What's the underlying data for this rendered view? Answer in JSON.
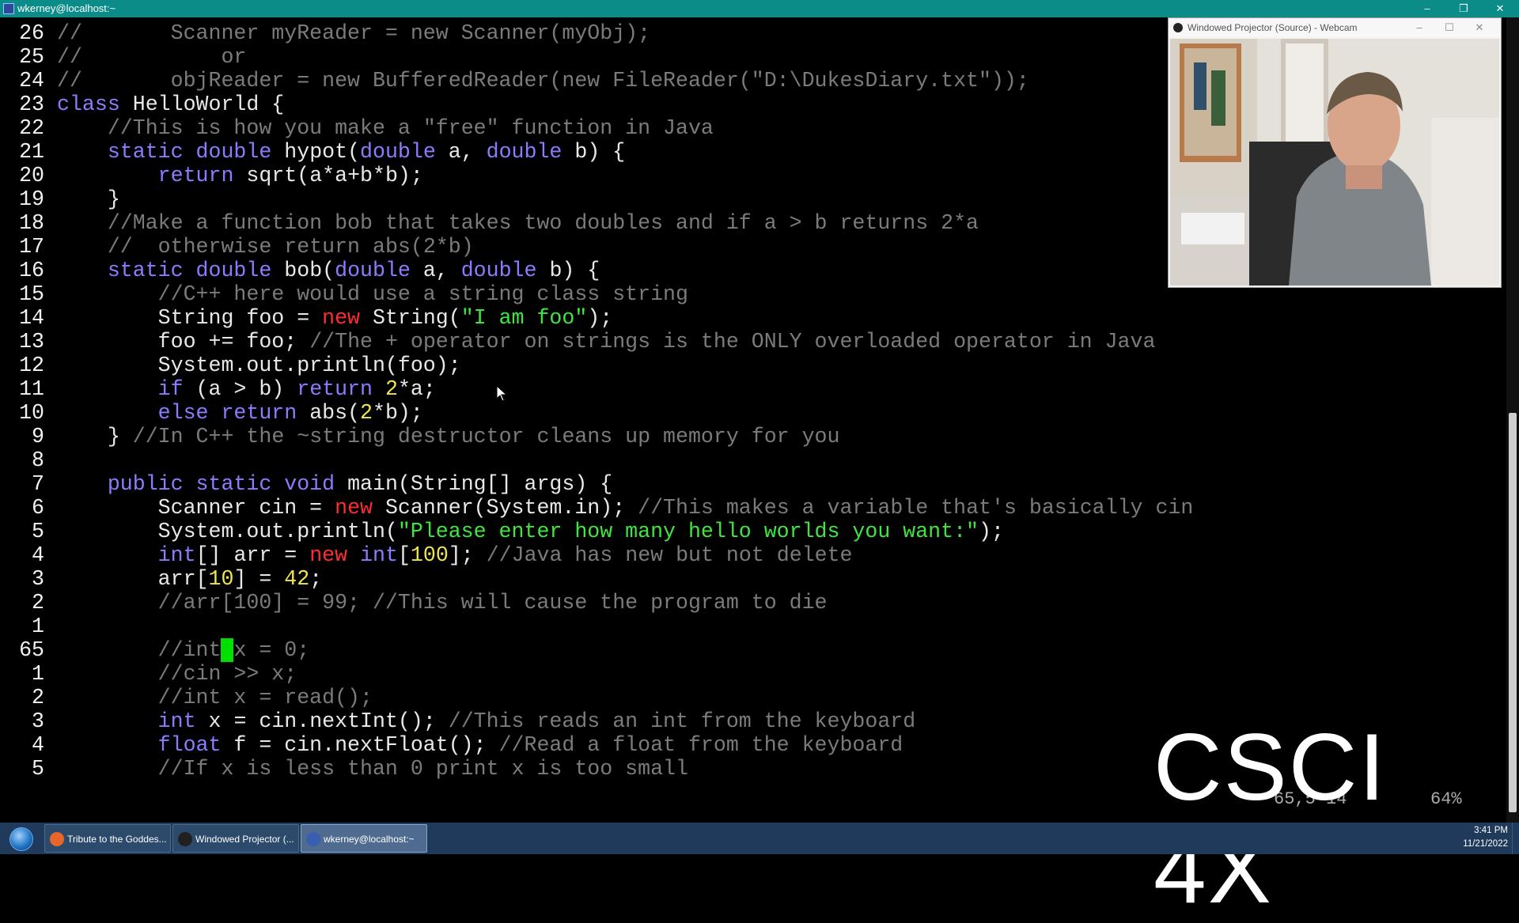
{
  "window": {
    "title": "wkerney@localhost:~",
    "controls": [
      "–",
      "❐",
      "✕"
    ]
  },
  "editor": {
    "lines": [
      {
        "n": "26",
        "segs": [
          [
            "cm",
            "//       Scanner myReader = new Scanner(myObj);"
          ]
        ]
      },
      {
        "n": "25",
        "segs": [
          [
            "cm",
            "//           or"
          ]
        ]
      },
      {
        "n": "24",
        "segs": [
          [
            "cm",
            "//       objReader = new BufferedReader(new FileReader(\"D:\\DukesDiary.txt\"));"
          ]
        ]
      },
      {
        "n": "23",
        "segs": [
          [
            "kw",
            "class"
          ],
          [
            "t",
            " HelloWorld {"
          ]
        ]
      },
      {
        "n": "22",
        "segs": [
          [
            "t",
            "    "
          ],
          [
            "cm",
            "//This is how you make a \"free\" function in Java"
          ]
        ]
      },
      {
        "n": "21",
        "segs": [
          [
            "t",
            "    "
          ],
          [
            "kw",
            "static double"
          ],
          [
            "t",
            " hypot("
          ],
          [
            "kw",
            "double"
          ],
          [
            "t",
            " a, "
          ],
          [
            "kw",
            "double"
          ],
          [
            "t",
            " b) {"
          ]
        ]
      },
      {
        "n": "20",
        "segs": [
          [
            "t",
            "        "
          ],
          [
            "kw",
            "return"
          ],
          [
            "t",
            " sqrt(a*a+b*b);"
          ]
        ]
      },
      {
        "n": "19",
        "segs": [
          [
            "t",
            "    }"
          ]
        ]
      },
      {
        "n": "18",
        "segs": [
          [
            "t",
            "    "
          ],
          [
            "cm",
            "//Make a function bob that takes two doubles and if a > b returns 2*a"
          ]
        ]
      },
      {
        "n": "17",
        "segs": [
          [
            "t",
            "    "
          ],
          [
            "cm",
            "//  otherwise return abs(2*b)"
          ]
        ]
      },
      {
        "n": "16",
        "segs": [
          [
            "t",
            "    "
          ],
          [
            "kw",
            "static double"
          ],
          [
            "t",
            " bob("
          ],
          [
            "kw",
            "double"
          ],
          [
            "t",
            " a, "
          ],
          [
            "kw",
            "double"
          ],
          [
            "t",
            " b) {"
          ]
        ]
      },
      {
        "n": "15",
        "segs": [
          [
            "t",
            "        "
          ],
          [
            "cm",
            "//C++ here would use a string class string"
          ]
        ]
      },
      {
        "n": "14",
        "segs": [
          [
            "t",
            "        String foo = "
          ],
          [
            "nw",
            "new"
          ],
          [
            "t",
            " String("
          ],
          [
            "str",
            "\"I am foo\""
          ],
          [
            "t",
            ");"
          ]
        ]
      },
      {
        "n": "13",
        "segs": [
          [
            "t",
            "        foo += foo; "
          ],
          [
            "cm",
            "//The + operator on strings is the ONLY overloaded operator in Java"
          ]
        ]
      },
      {
        "n": "12",
        "segs": [
          [
            "t",
            "        System.out.println(foo);"
          ]
        ]
      },
      {
        "n": "11",
        "segs": [
          [
            "t",
            "        "
          ],
          [
            "kw",
            "if"
          ],
          [
            "t",
            " (a > b) "
          ],
          [
            "kw",
            "return"
          ],
          [
            "t",
            " "
          ],
          [
            "num",
            "2"
          ],
          [
            "t",
            "*a;"
          ]
        ]
      },
      {
        "n": "10",
        "segs": [
          [
            "t",
            "        "
          ],
          [
            "kw",
            "else return"
          ],
          [
            "t",
            " abs("
          ],
          [
            "num",
            "2"
          ],
          [
            "t",
            "*b);"
          ]
        ]
      },
      {
        "n": "9",
        "segs": [
          [
            "t",
            "    } "
          ],
          [
            "cm",
            "//In C++ the ~string destructor cleans up memory for you"
          ]
        ]
      },
      {
        "n": "8",
        "segs": []
      },
      {
        "n": "7",
        "segs": [
          [
            "t",
            "    "
          ],
          [
            "kw",
            "public static void"
          ],
          [
            "t",
            " main(String[] args) {"
          ]
        ]
      },
      {
        "n": "6",
        "segs": [
          [
            "t",
            "        Scanner cin = "
          ],
          [
            "nw",
            "new"
          ],
          [
            "t",
            " Scanner(System.in); "
          ],
          [
            "cm",
            "//This makes a variable that's basically cin"
          ]
        ]
      },
      {
        "n": "5",
        "segs": [
          [
            "t",
            "        System.out.println("
          ],
          [
            "str",
            "\"Please enter how many hello worlds you want:\""
          ],
          [
            "t",
            ");"
          ]
        ]
      },
      {
        "n": "4",
        "segs": [
          [
            "t",
            "        "
          ],
          [
            "kw",
            "int"
          ],
          [
            "t",
            "[] arr = "
          ],
          [
            "nw",
            "new"
          ],
          [
            "t",
            " "
          ],
          [
            "kw",
            "int"
          ],
          [
            "t",
            "["
          ],
          [
            "num",
            "100"
          ],
          [
            "t",
            "]; "
          ],
          [
            "cm",
            "//Java has new but not delete"
          ]
        ]
      },
      {
        "n": "3",
        "segs": [
          [
            "t",
            "        arr["
          ],
          [
            "num",
            "10"
          ],
          [
            "t",
            "] = "
          ],
          [
            "num",
            "42"
          ],
          [
            "t",
            ";"
          ]
        ]
      },
      {
        "n": "2",
        "segs": [
          [
            "t",
            "        "
          ],
          [
            "cm",
            "//arr[100] = 99; //This will cause the program to die"
          ]
        ]
      },
      {
        "n": "1",
        "segs": []
      },
      {
        "n": "65",
        "segs": [
          [
            "t",
            "        "
          ],
          [
            "cm",
            "//int"
          ],
          [
            "cur",
            " "
          ],
          [
            "cm",
            "x = 0;"
          ]
        ]
      },
      {
        "n": "1",
        "segs": [
          [
            "t",
            "        "
          ],
          [
            "cm",
            "//cin >> x;"
          ]
        ]
      },
      {
        "n": "2",
        "segs": [
          [
            "t",
            "        "
          ],
          [
            "cm",
            "//int x = read();"
          ]
        ]
      },
      {
        "n": "3",
        "segs": [
          [
            "t",
            "        "
          ],
          [
            "kw",
            "int"
          ],
          [
            "t",
            " x = cin.nextInt(); "
          ],
          [
            "cm",
            "//This reads an int from the keyboard"
          ]
        ]
      },
      {
        "n": "4",
        "segs": [
          [
            "t",
            "        "
          ],
          [
            "kw",
            "float"
          ],
          [
            "t",
            " f = cin.nextFloat(); "
          ],
          [
            "cm",
            "//Read a float from the keyboard"
          ]
        ]
      },
      {
        "n": "5",
        "segs": [
          [
            "t",
            "        "
          ],
          [
            "cm",
            "//If x is less than 0 print x is too small"
          ]
        ]
      }
    ],
    "ruler": "65,5-14        64%"
  },
  "webcam": {
    "title": "Windowed Projector (Source) - Webcam",
    "controls": [
      "–",
      "☐",
      "✕"
    ]
  },
  "overlay": {
    "text": "CSCI 4X"
  },
  "taskbar": {
    "items": [
      {
        "label": "Tribute to the Goddes...",
        "active": false,
        "icon_color": "#e8662a"
      },
      {
        "label": "Windowed Projector (...",
        "active": false,
        "icon_color": "#202020"
      },
      {
        "label": "wkerney@localhost:~",
        "active": true,
        "icon_color": "#3b5fb0"
      }
    ],
    "clock": {
      "time": "3:41 PM",
      "date": "11/21/2022"
    }
  },
  "colors": {
    "titlebar": "#0c8c88",
    "keyword": "#8a7cff",
    "new_keyword": "#ff2d2d",
    "string": "#3ee63e",
    "number": "#f0e64a",
    "comment": "#7b7b7b",
    "cursor": "#00e000"
  }
}
